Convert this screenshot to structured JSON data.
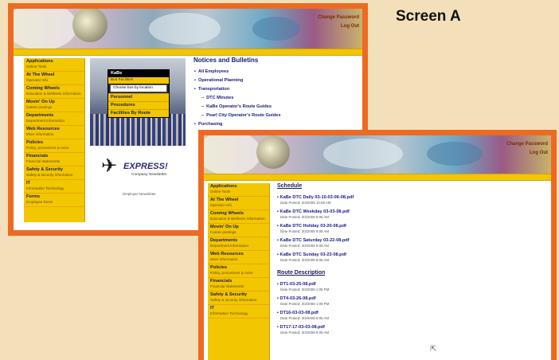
{
  "label": "Screen A",
  "banner_links": [
    "Change Password",
    "Log Out"
  ],
  "screen_a": {
    "breadcrumb": "",
    "sidebar": [
      {
        "title": "Applications",
        "sub": "Online Tools"
      },
      {
        "title": "At The Wheel",
        "sub": "Operator Info"
      },
      {
        "title": "Coming Wheels",
        "sub": "Education & Wellness information"
      },
      {
        "title": "Movin' On Up",
        "sub": "Career postings"
      },
      {
        "title": "Departments",
        "sub": "Department information"
      },
      {
        "title": "Web Resources",
        "sub": "More information"
      },
      {
        "title": "Policies",
        "sub": "Policy, procedures & more"
      },
      {
        "title": "Financials",
        "sub": "Financial statements"
      },
      {
        "title": "Safety & Security",
        "sub": "Safety & security information"
      },
      {
        "title": "IT",
        "sub": "Information Technology"
      },
      {
        "title": "Forms",
        "sub": "Employee forms"
      }
    ],
    "menu": {
      "head": "KaBe",
      "sub": "Bus Facilities",
      "select": "Choose bus by location",
      "groups": [
        "Personnel",
        "Procedures",
        "Facilities By Route"
      ]
    },
    "express": {
      "brand": "EXPRESS!",
      "tag": "Company Newsletter",
      "addr": "Employee Newsletter"
    },
    "notices": {
      "title": "Notices and Bulletins",
      "items": [
        {
          "label": "All Employees",
          "sub": false
        },
        {
          "label": "Operational Planning",
          "sub": false
        },
        {
          "label": "Transportation",
          "sub": false
        },
        {
          "label": "DTC Minutes",
          "sub": true
        },
        {
          "label": "KaBe Operator's Route Guides",
          "sub": true
        },
        {
          "label": "Pearl City Operator's Route Guides",
          "sub": true
        },
        {
          "label": "Purchasing",
          "sub": false
        }
      ]
    }
  },
  "screen_b": {
    "breadcrumb": "",
    "sidebar": [
      {
        "title": "Applications",
        "sub": "Online Tools"
      },
      {
        "title": "At The Wheel",
        "sub": "Operator Info"
      },
      {
        "title": "Coming Wheels",
        "sub": "Education & Wellness information"
      },
      {
        "title": "Movin' On Up",
        "sub": "Career postings"
      },
      {
        "title": "Departments",
        "sub": "Department information"
      },
      {
        "title": "Web Resources",
        "sub": "More information"
      },
      {
        "title": "Policies",
        "sub": "Policy, procedures & more"
      },
      {
        "title": "Financials",
        "sub": "Financial statements"
      },
      {
        "title": "Safety & Security",
        "sub": "Safety & security information"
      },
      {
        "title": "IT",
        "sub": "Information Technology"
      }
    ],
    "schedule_title": "Schedule",
    "schedule": [
      {
        "name": "KaBe DTC Daily 03-10-03-06-08.pdf",
        "date": "Date Posted: 3/3/2008 10:08 AM"
      },
      {
        "name": "KaBe DTC Weekday 03-03-08.pdf",
        "date": "Date Posted: 3/3/2008 9:05 AM"
      },
      {
        "name": "KaBe DTC Holiday 03-20-08.pdf",
        "date": "Date Posted: 3/3/2008 9:05 AM"
      },
      {
        "name": "KaBe DTC Saturday 03-22-08.pdf",
        "date": "Date Posted: 3/3/2008 9:05 AM"
      },
      {
        "name": "KaBe DTC Sunday 03-23-08.pdf",
        "date": "Date Posted: 3/3/2008 9:05 AM"
      }
    ],
    "route_title": "Route Description",
    "routes": [
      {
        "name": "DT1-03-25-08.pdf",
        "date": "Date Posted: 3/3/2008 1:05 PM"
      },
      {
        "name": "DT4-03-26-08.pdf",
        "date": "Date Posted: 3/3/2008 1:05 PM"
      },
      {
        "name": "DT16-03-03-08.pdf",
        "date": "Date Posted: 3/3/2008 9:05 AM"
      },
      {
        "name": "DT17-17-03-03-08.pdf",
        "date": "Date Posted: 3/3/2008 9:05 AM"
      }
    ]
  }
}
